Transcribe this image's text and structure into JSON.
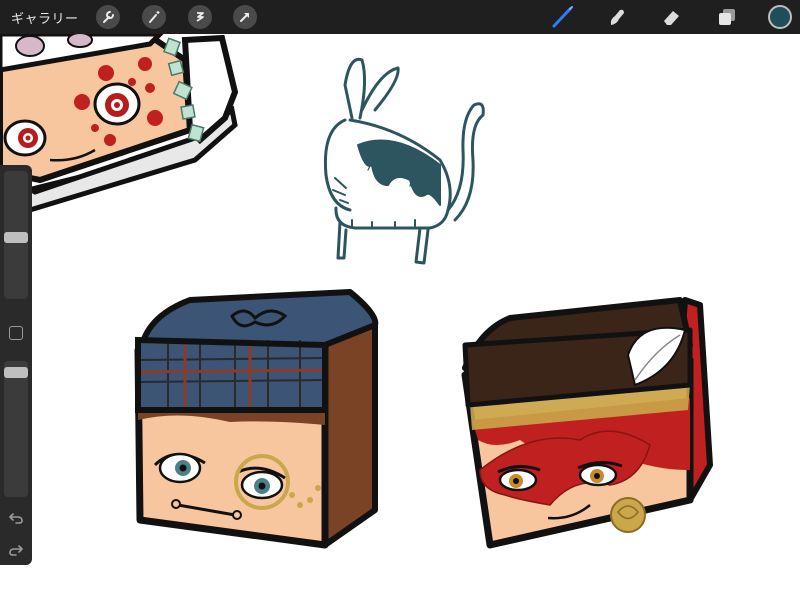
{
  "topbar": {
    "gallery_label": "ギャラリー",
    "left_tools": [
      "wrench-icon",
      "magic-wand-icon",
      "selection-icon",
      "transform-arrow-icon"
    ],
    "right_tools": [
      "brush-icon",
      "smudge-icon",
      "eraser-icon",
      "layers-icon"
    ],
    "active_tool": "brush-icon",
    "active_color": "#1f4e5a",
    "accent_color": "#2f7cf6"
  },
  "sidebar": {
    "size_slider_level": 0.48,
    "opacity_slider_level": 0.05,
    "buttons": [
      "modify-square-icon",
      "undo-icon",
      "redo-icon"
    ]
  },
  "canvas": {
    "drawings": [
      "character-block-top-left",
      "cat-sketch",
      "character-block-plaid-cap",
      "character-block-masked"
    ],
    "palette": {
      "ink": "#111111",
      "skin": "#f8c69e",
      "navy": "#3c5475",
      "dark_brown": "#3a2518",
      "hair_brown": "#7a4325",
      "teal_sketch": "#2d5560",
      "red_mask": "#c0201f",
      "gold": "#c9a74a"
    }
  }
}
